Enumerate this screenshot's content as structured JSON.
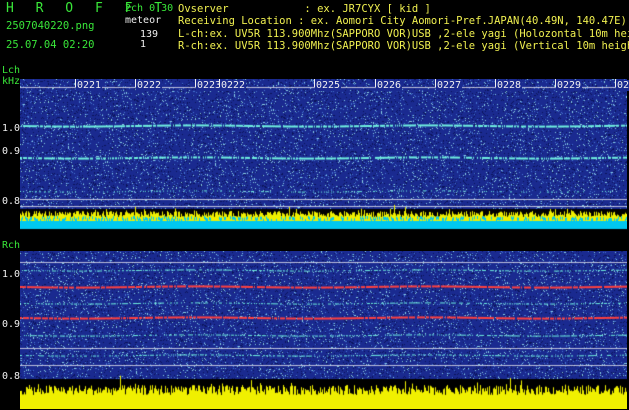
{
  "header": {
    "app_title": "H R O F F T",
    "version": "2ch 0.30",
    "file_name": "2507040220.png",
    "mode": "meteor",
    "count_l": "139",
    "count_r": "1",
    "datetime": "25.07.04 02:20",
    "observer": "Ovserver            : ex. JR7CYX [ kid ]",
    "location": "Receiving Location : ex. Aomori City Aomori-Pref.JAPAN(40.49N, 140.47E)",
    "lch_desc": "L-ch:ex. UV5R 113.900Mhz(SAPPORO VOR)USB ,2-ele yagi (Holozontal 10m height)",
    "rch_desc": "R-ch:ex. UV5R 113.900Mhz(SAPPORO VOR)USB ,2-ele yagi (Vertical 10m height)"
  },
  "lpanel": {
    "label": "Lch",
    "unit": "kHz",
    "ticks": [
      "1.0",
      "0.9",
      "0.8"
    ],
    "minutes": [
      "0221",
      "0222",
      "0223",
      "0222",
      "0225",
      "0226",
      "0227",
      "0228",
      "0229",
      "0230"
    ]
  },
  "rpanel": {
    "label": "Rch",
    "ticks": [
      "1.0",
      "0.9",
      "0.8"
    ]
  },
  "colors": {
    "text_green": "#39e639",
    "text_white": "#f0f0f0",
    "spectrum_bg": "#1a2a90",
    "signal_cyan": "#6ff0e0",
    "signal_red": "#ff4040",
    "bar_yellow": "#f0f000",
    "bar_cyan": "#00c8f0"
  }
}
